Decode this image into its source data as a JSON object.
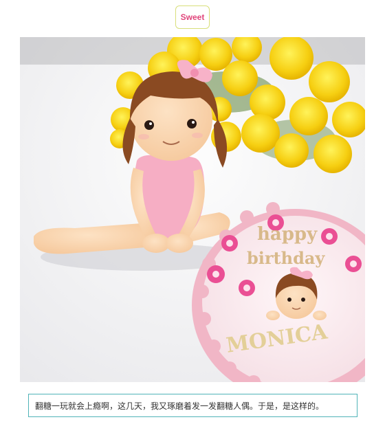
{
  "header": {
    "badge_label": "Sweet",
    "badge_color": "#e0457b",
    "badge_border": "#d8df7a"
  },
  "photo": {
    "cake_line1": "happy",
    "cake_line2": "birthday",
    "cake_name": "MONICA"
  },
  "caption": {
    "text": "翻糖一玩就会上瘾啊，这几天，我又琢磨着发一发翻糖人偶。于是，是这样的。",
    "border_color": "#4fb3b7"
  }
}
